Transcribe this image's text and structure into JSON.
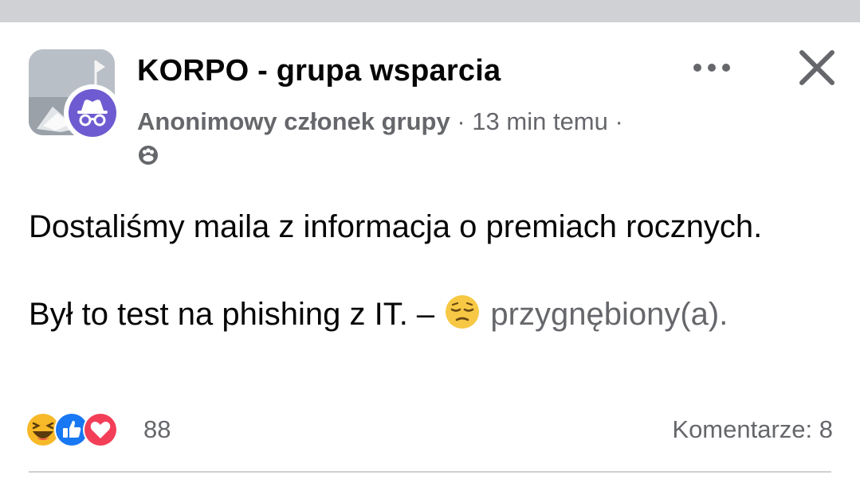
{
  "post": {
    "group_name": "KORPO - grupa wsparcia",
    "author": "Anonimowy członek grupy",
    "separator": "·",
    "time": "13 min temu",
    "privacy_icon": "members-icon",
    "body_line1": "Dostaliśmy maila z informacja o premiach rocznych.",
    "body_line2_prefix": "Był to test na phishing z IT. – ",
    "feeling_text": "przygnębiony(a).",
    "feeling_icon": "pensive-face-icon"
  },
  "footer": {
    "reaction_icons": [
      "haha-icon",
      "like-icon",
      "love-icon"
    ],
    "reaction_count": "88",
    "comments_label": "Komentarze: 8"
  },
  "header_actions": {
    "more_icon": "more-dots-icon",
    "close_icon": "close-icon"
  },
  "colors": {
    "anon_badge": "#6f5bd1",
    "secondary_text": "#65676b",
    "like_blue": "#1877f2",
    "love_red": "#f33e58",
    "haha_yellow": "#f7b928"
  }
}
